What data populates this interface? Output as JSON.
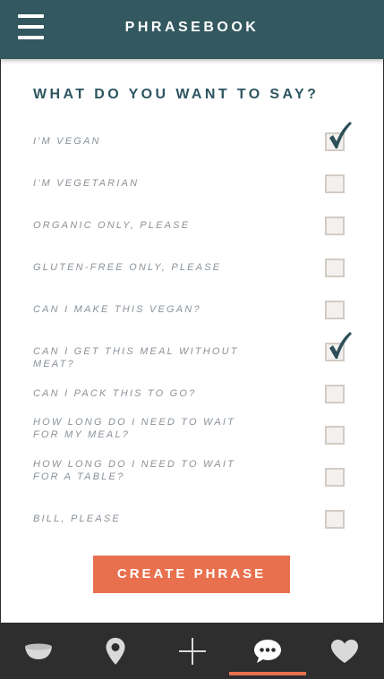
{
  "header": {
    "title": "PHRASEBOOK",
    "menu_icon": "hamburger-icon"
  },
  "question": "WHAT DO YOU WANT TO SAY?",
  "phrases": [
    {
      "text": "I'M VEGAN",
      "checked": true
    },
    {
      "text": "I'M VEGETARIAN",
      "checked": false
    },
    {
      "text": "ORGANIC ONLY, PLEASE",
      "checked": false
    },
    {
      "text": "GLUTEN-FREE ONLY, PLEASE",
      "checked": false
    },
    {
      "text": "CAN I MAKE THIS VEGAN?",
      "checked": false
    },
    {
      "text": "CAN I GET THIS MEAL WITHOUT MEAT?",
      "checked": true
    },
    {
      "text": "CAN I PACK THIS TO GO?",
      "checked": false
    },
    {
      "text": "HOW LONG DO I NEED TO WAIT FOR MY MEAL?",
      "checked": false
    },
    {
      "text": "HOW LONG DO I NEED TO WAIT FOR A TABLE?",
      "checked": false
    },
    {
      "text": "BILL, PLEASE",
      "checked": false
    }
  ],
  "create_button_label": "CREATE PHRASE",
  "bottom_nav": {
    "items": [
      {
        "icon": "bowl-icon",
        "active": false
      },
      {
        "icon": "location-pin-icon",
        "active": false
      },
      {
        "icon": "plus-icon",
        "active": false
      },
      {
        "icon": "chat-bubble-icon",
        "active": true
      },
      {
        "icon": "heart-icon",
        "active": false
      }
    ]
  },
  "colors": {
    "header_bg": "#33585f",
    "heading_text": "#2d5560",
    "accent": "#e8704e",
    "nav_bg": "#2e2e2e",
    "phrase_text": "#8a9299",
    "check_color": "#2d4f57"
  }
}
